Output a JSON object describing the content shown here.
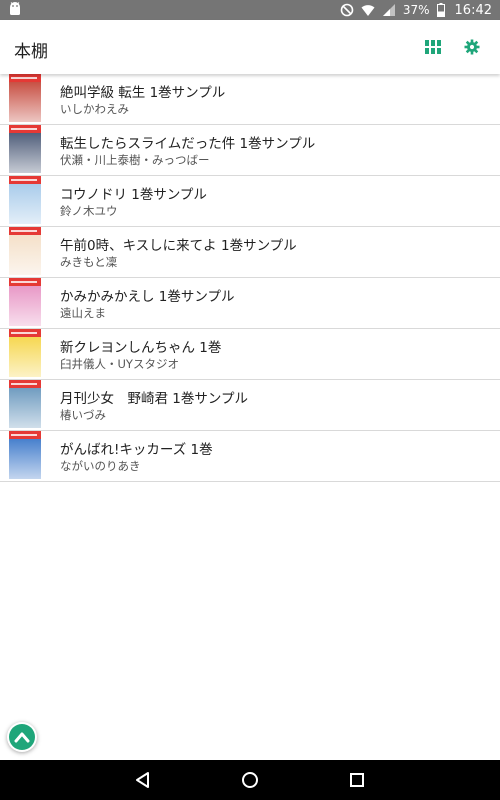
{
  "status_bar": {
    "battery_percent": "37%",
    "time": "16:42",
    "icons": [
      "android-icon",
      "do-not-disturb-icon",
      "wifi-icon",
      "signal-icon",
      "battery-icon"
    ]
  },
  "app_bar": {
    "title": "本棚",
    "actions": [
      "grid-view-icon",
      "settings-gear-icon"
    ],
    "accent": "#1fa67a"
  },
  "books": [
    {
      "title": "絶叫学級 転生 1巻サンプル",
      "author": "いしかわえみ",
      "cover_color": "#c0392b"
    },
    {
      "title": "転生したらスライムだった件 1巻サンプル",
      "author": "伏瀬・川上泰樹・みっつばー",
      "cover_color": "#3a4a6a"
    },
    {
      "title": "コウノドリ 1巻サンプル",
      "author": "鈴ノ木ユウ",
      "cover_color": "#9ec5e8"
    },
    {
      "title": "午前0時、キスしに来てよ 1巻サンプル",
      "author": "みきもと凜",
      "cover_color": "#f3dcc2"
    },
    {
      "title": "かみかみかえし 1巻サンプル",
      "author": "遠山えま",
      "cover_color": "#e58bbf"
    },
    {
      "title": "新クレヨンしんちゃん 1巻",
      "author": "臼井儀人・UYスタジオ",
      "cover_color": "#f5d23a"
    },
    {
      "title": "月刊少女　野崎君 1巻サンプル",
      "author": "椿いづみ",
      "cover_color": "#5d8fb8"
    },
    {
      "title": "がんばれ!キッカーズ 1巻",
      "author": "ながいのりあき",
      "cover_color": "#2f6fc6"
    }
  ],
  "fab": {
    "icon": "chevron-up-icon"
  },
  "nav_bar": {
    "buttons": [
      "back-icon",
      "home-icon",
      "recents-icon"
    ]
  }
}
